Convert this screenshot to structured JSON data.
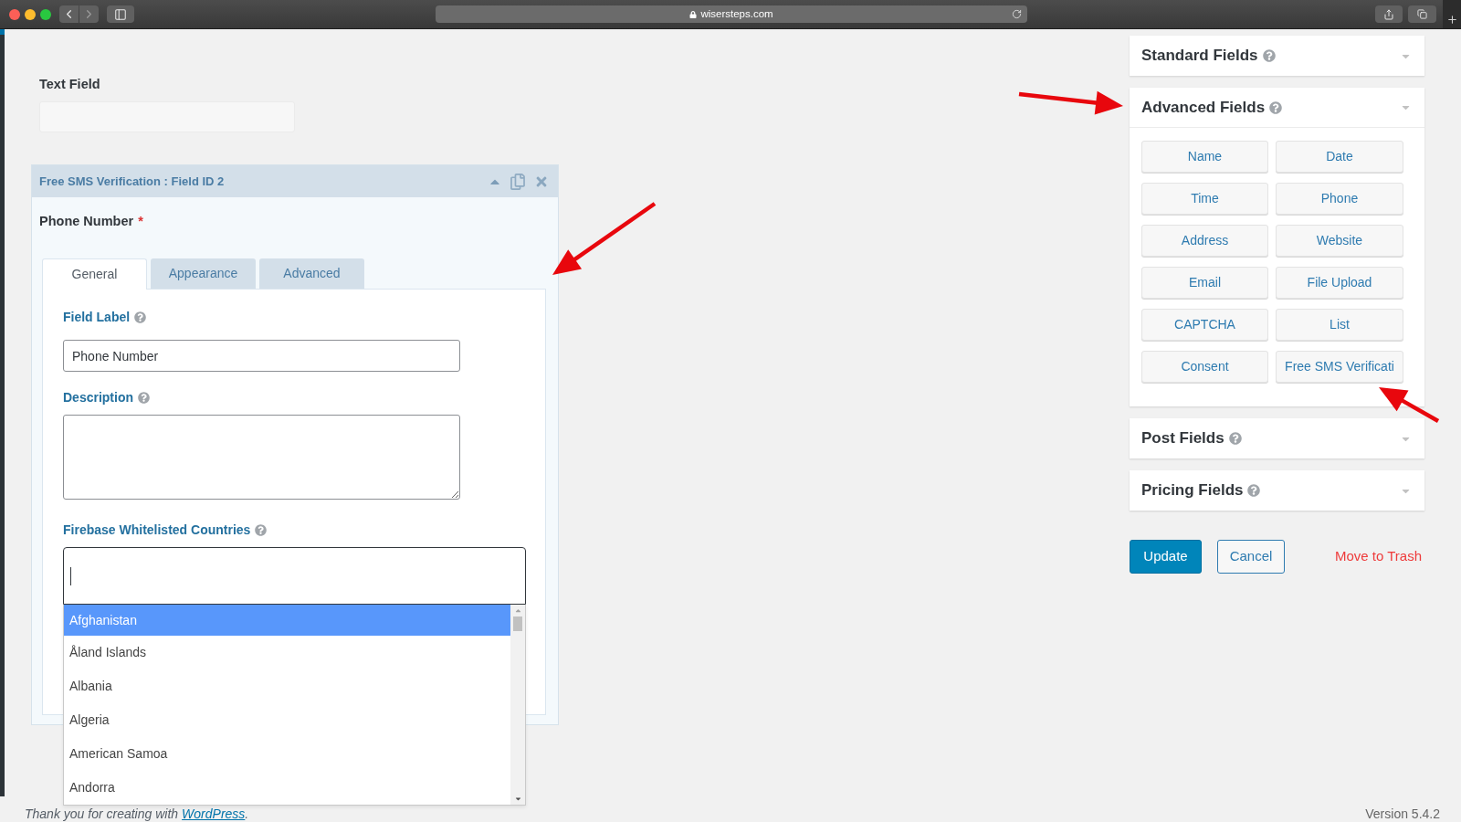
{
  "browser": {
    "address": "wisersteps.com"
  },
  "form_preview": {
    "label": "Text Field"
  },
  "field_editor": {
    "title": "Free SMS Verification : Field ID 2",
    "annotated": true,
    "field_name": "Phone Number",
    "required_mark": "*",
    "tabs": [
      {
        "label": "General",
        "selected": true
      },
      {
        "label": "Appearance",
        "selected": false
      },
      {
        "label": "Advanced",
        "selected": false
      }
    ],
    "field_label": {
      "label": "Field Label",
      "value": "Phone Number"
    },
    "description": {
      "label": "Description"
    },
    "whitelisted_countries": {
      "label": "Firebase Whitelisted Countries",
      "options": [
        {
          "label": "Afghanistan",
          "selected": true
        },
        {
          "label": "Åland Islands",
          "selected": false
        },
        {
          "label": "Albania",
          "selected": false
        },
        {
          "label": "Algeria",
          "selected": false
        },
        {
          "label": "American Samoa",
          "selected": false
        },
        {
          "label": "Andorra",
          "selected": false
        }
      ]
    }
  },
  "field_groups": [
    {
      "title": "Standard Fields",
      "expanded": false,
      "annotated": false
    },
    {
      "title": "Advanced Fields",
      "expanded": true,
      "annotated": true,
      "buttons": [
        {
          "label": "Name",
          "annotated": false
        },
        {
          "label": "Date",
          "annotated": false
        },
        {
          "label": "Time",
          "annotated": false
        },
        {
          "label": "Phone",
          "annotated": false
        },
        {
          "label": "Address",
          "annotated": false
        },
        {
          "label": "Website",
          "annotated": false
        },
        {
          "label": "Email",
          "annotated": false
        },
        {
          "label": "File Upload",
          "annotated": false
        },
        {
          "label": "CAPTCHA",
          "annotated": false
        },
        {
          "label": "List",
          "annotated": false
        },
        {
          "label": "Consent",
          "annotated": false
        },
        {
          "label": "Free SMS Verificati",
          "annotated": true
        }
      ]
    },
    {
      "title": "Post Fields",
      "expanded": false,
      "annotated": false
    },
    {
      "title": "Pricing Fields",
      "expanded": false,
      "annotated": false
    }
  ],
  "actions": {
    "update": "Update",
    "cancel": "Cancel",
    "trash": "Move to Trash"
  },
  "footer": {
    "credit": "Thank you for creating with",
    "link": "WordPress",
    "credit_end": ".",
    "version": "Version 5.4.2"
  }
}
